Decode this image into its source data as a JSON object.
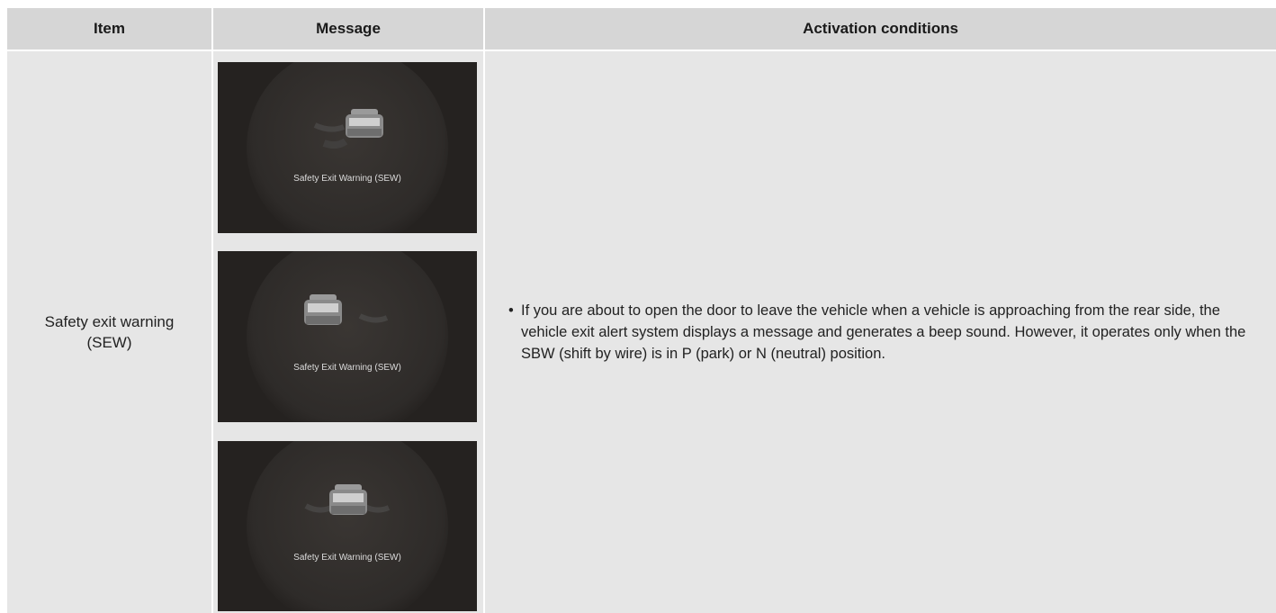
{
  "table": {
    "headers": {
      "item": "Item",
      "message": "Message",
      "activation": "Activation conditions"
    },
    "rows": [
      {
        "item": "Safety exit warning\n(SEW)",
        "messages": [
          {
            "caption": "Safety Exit Warning (SEW)",
            "icon": "car-rear-view-icon"
          },
          {
            "caption": "Safety Exit Warning (SEW)",
            "icon": "car-rear-view-icon"
          },
          {
            "caption": "Safety Exit Warning (SEW)",
            "icon": "car-rear-view-icon"
          }
        ],
        "activation": [
          "If you are about to open the door to leave the vehicle when a vehicle is approaching from the rear side, the vehicle exit alert system displays a message and generates a beep sound. However, it operates only when the SBW (shift by wire) is in P (park) or N (neutral) position."
        ]
      }
    ]
  },
  "colors": {
    "header_bg": "#d6d6d6",
    "cell_bg": "#e6e6e6",
    "screen_bg": "#2a2725"
  }
}
